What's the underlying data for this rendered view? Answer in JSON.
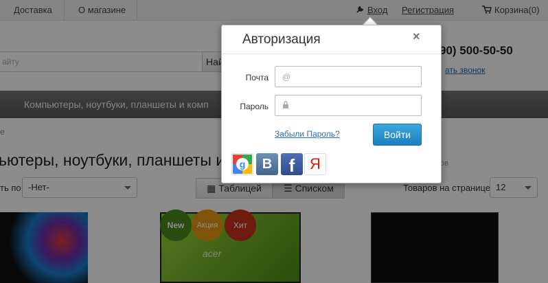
{
  "topbar": {
    "delivery": "Доставка",
    "about": "О магазине",
    "login": "Вход",
    "register": "Регистрация",
    "cart": "Корзина(0)"
  },
  "header": {
    "search_placeholder": "айту",
    "search_button": "Най",
    "phone": "90) 500-50-50",
    "callback": "ать звонок"
  },
  "category_bar": "Компьютеры, ноутбуки, планшеты и комп",
  "breadcrumb": "е",
  "page_title": "ьютеры, ноутбуки, планшеты и",
  "count_text": "ов",
  "controls": {
    "sort_label": "ть по:",
    "sort_value": "-Нет-",
    "view_table": "Таблицей",
    "view_list": "Списком",
    "per_page_label": "Товаров на странице:",
    "per_page_value": "12"
  },
  "badges": {
    "new": "New",
    "sale": "Акция",
    "hit": "Хит"
  },
  "product_brand": "acer",
  "modal": {
    "title": "Авторизация",
    "close": "×",
    "email_label": "Почта",
    "email_icon": "@",
    "password_label": "Пароль",
    "forgot": "Забыли Пароль?",
    "login_button": "Войти",
    "social_vk": "B",
    "social_fb": "f",
    "social_ya": "Я"
  }
}
